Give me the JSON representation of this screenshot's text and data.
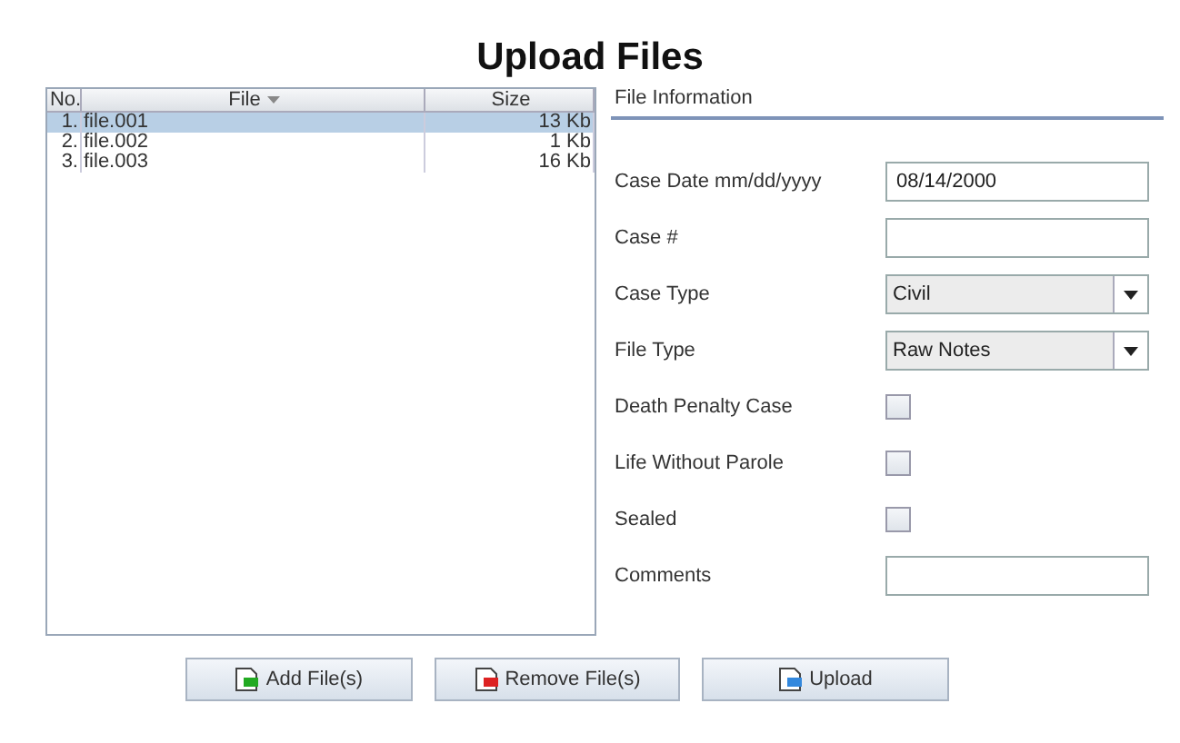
{
  "title": "Upload Files",
  "table": {
    "columns": [
      {
        "label": "No.",
        "sorted": false
      },
      {
        "label": "File",
        "sorted": true
      },
      {
        "label": "Size",
        "sorted": false
      }
    ],
    "rows": [
      {
        "cells": [
          "1.",
          "file.001",
          "13 Kb"
        ],
        "selected": true
      },
      {
        "cells": [
          "2.",
          "file.002",
          "1 Kb"
        ],
        "selected": false
      },
      {
        "cells": [
          "3.",
          "file.003",
          "16 Kb"
        ],
        "selected": false
      }
    ]
  },
  "form": {
    "heading": "File Information",
    "fields": [
      {
        "kind": "text",
        "label": "Case Date mm/dd/yyyy",
        "value": "08/14/2000"
      },
      {
        "kind": "text",
        "label": "Case #"
      },
      {
        "kind": "select",
        "label": "Case Type",
        "value": "Civil"
      },
      {
        "kind": "select",
        "label": "File Type",
        "value": "Raw Notes"
      },
      {
        "kind": "checkbox",
        "label": "Death Penalty Case",
        "checked": false
      },
      {
        "kind": "checkbox",
        "label": "Life Without Parole",
        "checked": false
      },
      {
        "kind": "checkbox",
        "label": "Sealed",
        "checked": false
      },
      {
        "kind": "text",
        "label": "Comments"
      }
    ]
  },
  "buttons": [
    {
      "kind": "add",
      "label": "Add File(s)"
    },
    {
      "kind": "remove",
      "label": "Remove File(s)"
    },
    {
      "kind": "upload",
      "label": "Upload"
    }
  ]
}
